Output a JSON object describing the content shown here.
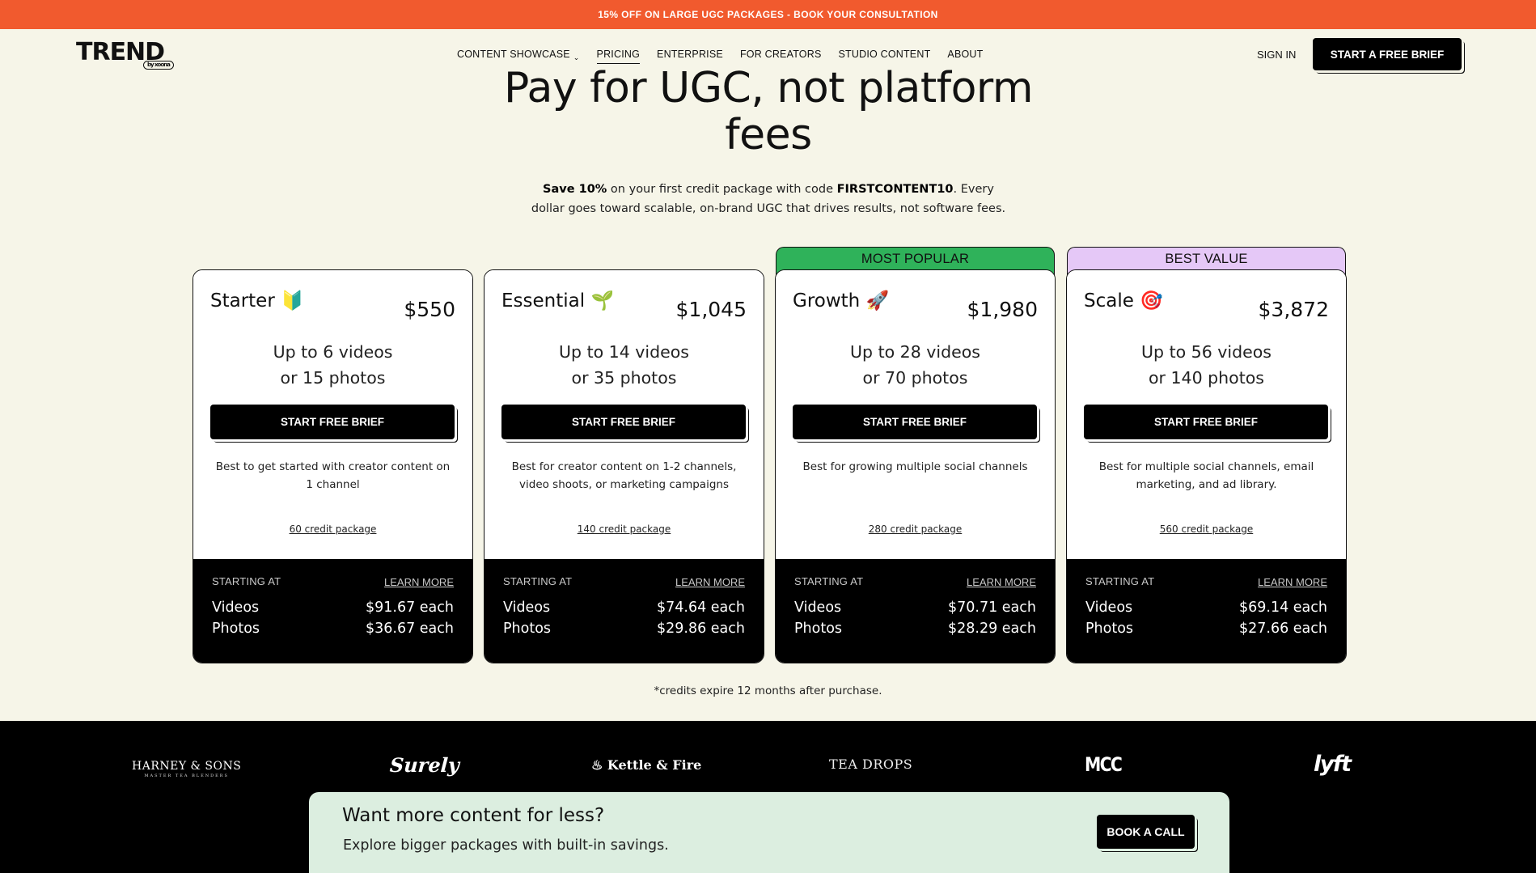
{
  "promo": "15% OFF ON LARGE UGC PACKAGES - BOOK YOUR CONSULTATION",
  "header": {
    "logo": "TREND",
    "logo_sub": "by xoona",
    "nav": [
      "CONTENT SHOWCASE",
      "PRICING",
      "ENTERPRISE",
      "FOR CREATORS",
      "STUDIO CONTENT",
      "ABOUT"
    ],
    "active_nav": "PRICING",
    "sign_in": "SIGN IN",
    "cta": "START A FREE BRIEF"
  },
  "hero": {
    "title": "Pay for UGC, not platform fees",
    "sub_bold1": "Save 10%",
    "sub_text1": " on your first credit package with code ",
    "sub_code": "FIRSTCONTENT10",
    "sub_text2": ". Every dollar goes toward scalable, on-brand UGC that drives results, not software fees."
  },
  "plans": [
    {
      "banner": "",
      "name": "Starter",
      "emoji": "🔰",
      "price": "$550",
      "volume1": "Up to 6 videos",
      "volume2": "or 15 photos",
      "cta": "START FREE BRIEF",
      "desc": "Best to get started with creator content on 1 channel",
      "credits": "60 credit package",
      "starting": "STARTING AT",
      "learn": "LEARN MORE",
      "video_label": "Videos",
      "video_price": "$91.67 each",
      "photo_label": "Photos",
      "photo_price": "$36.67 each"
    },
    {
      "banner": "",
      "name": "Essential",
      "emoji": "🌱",
      "price": "$1,045",
      "volume1": "Up to 14 videos",
      "volume2": "or 35 photos",
      "cta": "START FREE BRIEF",
      "desc": "Best for creator content on 1-2 channels, video shoots, or marketing campaigns",
      "credits": "140 credit package",
      "starting": "STARTING AT",
      "learn": "LEARN MORE",
      "video_label": "Videos",
      "video_price": "$74.64 each",
      "photo_label": "Photos",
      "photo_price": "$29.86 each"
    },
    {
      "banner": "MOST POPULAR",
      "banner_color": "#2fb25a",
      "name": "Growth",
      "emoji": "🚀",
      "price": "$1,980",
      "volume1": "Up to 28 videos",
      "volume2": "or 70 photos",
      "cta": "START FREE BRIEF",
      "desc": "Best for growing multiple social channels",
      "credits": "280 credit package",
      "starting": "STARTING AT",
      "learn": "LEARN MORE",
      "video_label": "Videos",
      "video_price": "$70.71 each",
      "photo_label": "Photos",
      "photo_price": "$28.29 each"
    },
    {
      "banner": "BEST VALUE",
      "banner_color": "#e5c8f7",
      "name": "Scale",
      "emoji": "🎯",
      "price": "$3,872",
      "volume1": "Up to 56 videos",
      "volume2": "or 140 photos",
      "cta": "START FREE BRIEF",
      "desc": "Best for multiple social channels, email marketing, and ad library.",
      "credits": "560 credit package",
      "starting": "STARTING AT",
      "learn": "LEARN MORE",
      "video_label": "Videos",
      "video_price": "$69.14 each",
      "photo_label": "Photos",
      "photo_price": "$27.66 each"
    }
  ],
  "credits_note": "*credits expire 12 months after purchase.",
  "brands": {
    "harney": "HARNEY & SONS",
    "harney_sub": "MASTER TEA BLENDERS",
    "surely": "Surely",
    "kettle": "Kettle & Fire",
    "teadrops": "TEA DROPS",
    "mcc": "MCC",
    "lyft": "lyft"
  },
  "bottom": {
    "title": "Want more content for less?",
    "sub": "Explore bigger packages with built-in savings.",
    "cta": "BOOK A CALL"
  },
  "colors": {
    "promo": "#f15a2e",
    "background": "#f6f5e8",
    "most_popular": "#2fb25a",
    "best_value": "#e5c8f7",
    "bottom_cta": "#dceee0"
  }
}
